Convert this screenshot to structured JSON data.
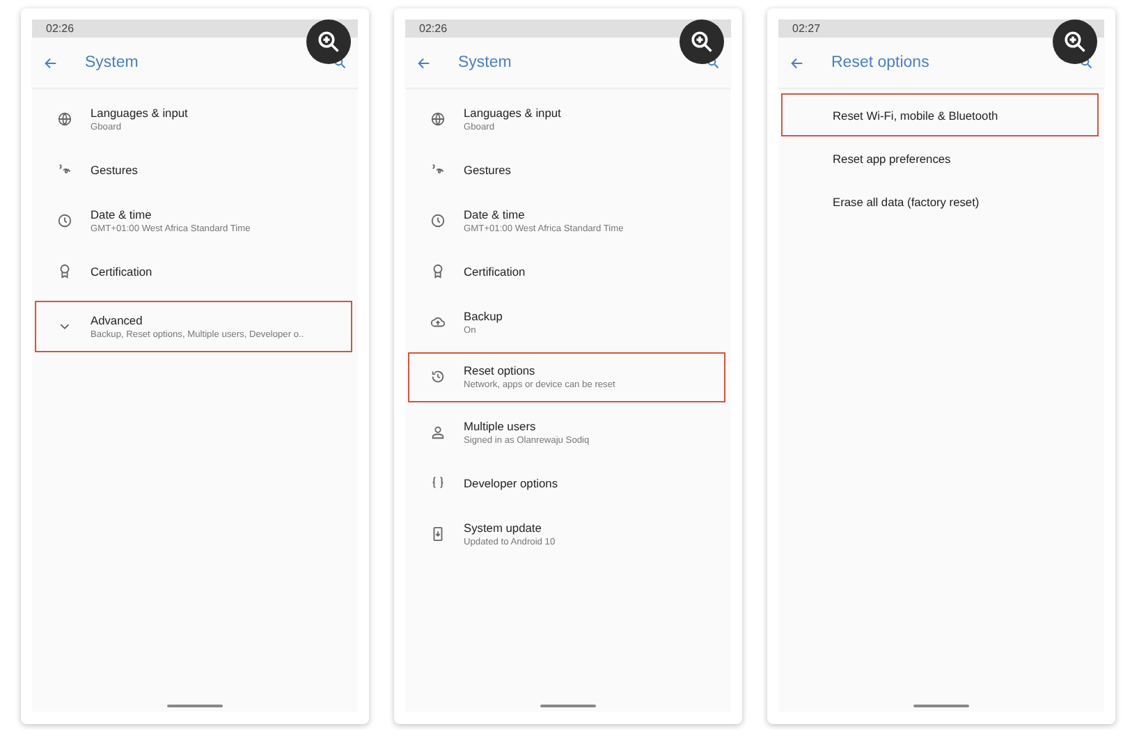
{
  "screens": [
    {
      "time": "02:26",
      "title": "System",
      "items": [
        {
          "kind": "globe",
          "title": "Languages & input",
          "subtitle": "Gboard",
          "highlighted": false
        },
        {
          "kind": "gesture",
          "title": "Gestures",
          "highlighted": false
        },
        {
          "kind": "clock",
          "title": "Date & time",
          "subtitle": "GMT+01:00 West Africa Standard Time",
          "highlighted": false
        },
        {
          "kind": "badge",
          "title": "Certification",
          "highlighted": false
        },
        {
          "kind": "chevron",
          "title": "Advanced",
          "subtitle": "Backup, Reset options, Multiple users, Developer o..",
          "highlighted": true
        }
      ]
    },
    {
      "time": "02:26",
      "title": "System",
      "items": [
        {
          "kind": "globe",
          "title": "Languages & input",
          "subtitle": "Gboard",
          "highlighted": false
        },
        {
          "kind": "gesture",
          "title": "Gestures",
          "highlighted": false
        },
        {
          "kind": "clock",
          "title": "Date & time",
          "subtitle": "GMT+01:00 West Africa Standard Time",
          "highlighted": false
        },
        {
          "kind": "badge",
          "title": "Certification",
          "highlighted": false
        },
        {
          "kind": "cloud",
          "title": "Backup",
          "subtitle": "On",
          "highlighted": false
        },
        {
          "kind": "history",
          "title": "Reset options",
          "subtitle": "Network, apps or device can be reset",
          "highlighted": true
        },
        {
          "kind": "person",
          "title": "Multiple users",
          "subtitle": "Signed in as Olanrewaju Sodiq",
          "highlighted": false
        },
        {
          "kind": "braces",
          "title": "Developer options",
          "highlighted": false
        },
        {
          "kind": "phone",
          "title": "System update",
          "subtitle": "Updated to Android 10",
          "highlighted": false
        }
      ]
    },
    {
      "time": "02:27",
      "title": "Reset options",
      "items": [
        {
          "kind": "plain",
          "title": "Reset Wi-Fi, mobile & Bluetooth",
          "highlighted": true
        },
        {
          "kind": "plain",
          "title": "Reset app preferences",
          "highlighted": false
        },
        {
          "kind": "plain",
          "title": "Erase all data (factory reset)",
          "highlighted": false
        }
      ]
    }
  ]
}
